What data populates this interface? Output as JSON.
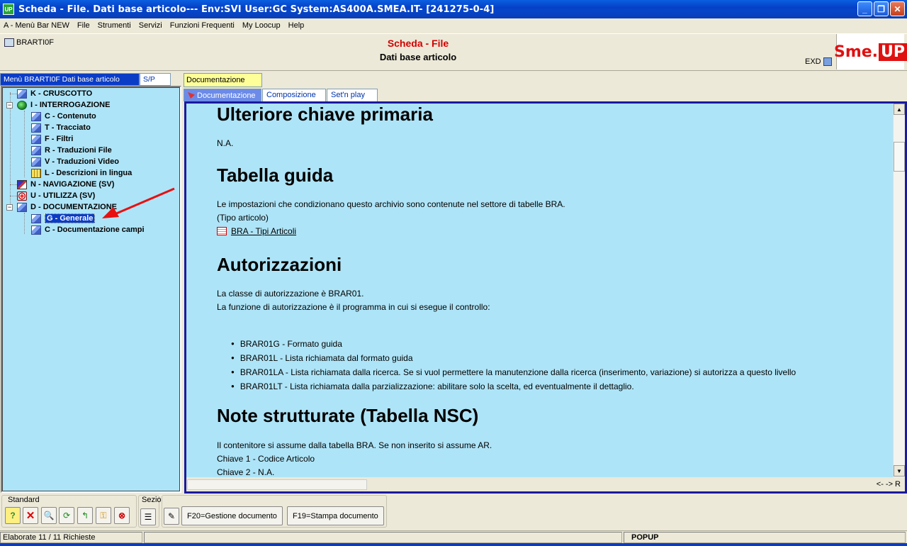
{
  "window": {
    "title": "Scheda - File. Dati base articolo--- Env:SVI User:GC System:AS400A.SMEA.IT- [241275-0-4]",
    "app_icon": "UP",
    "buttons": [
      "_",
      "❐",
      "✕"
    ]
  },
  "menu": [
    "A - Menù Bar NEW",
    "File",
    "Strumenti",
    "Servizi",
    "Funzioni Frequenti",
    "My Loocup",
    "Help"
  ],
  "header": {
    "object": "BRARTI0F",
    "title": "Scheda - File",
    "subtitle": "Dati base articolo",
    "exd": "EXD",
    "logo_left": "Sme.",
    "logo_right": "UP",
    "brand_color": "#e01010"
  },
  "left_panel": {
    "tab_active": "Menù BRARTI0F Dati base articolo",
    "tab_other": "S/P",
    "tree": [
      {
        "label": "K - CRUSCOTTO",
        "icon": "page-icon"
      },
      {
        "label": "I - INTERROGAZIONE",
        "icon": "globe-icon",
        "expander": "−"
      },
      {
        "label": "C - Contenuto",
        "icon": "page-icon"
      },
      {
        "label": "T - Tracciato",
        "icon": "page-icon"
      },
      {
        "label": "F - Filtri",
        "icon": "page-icon"
      },
      {
        "label": "R - Traduzioni File",
        "icon": "page-icon"
      },
      {
        "label": "V - Traduzioni Video",
        "icon": "page-icon"
      },
      {
        "label": "L - Descrizioni in lingua",
        "icon": "grid-icon"
      },
      {
        "label": "N - NAVIGAZIONE (SV)",
        "icon": "navigation-icon"
      },
      {
        "label": "U - UTILIZZA (SV)",
        "icon": "use-icon"
      },
      {
        "label": "D - DOCUMENTAZIONE",
        "icon": "page-icon",
        "expander": "−"
      },
      {
        "label": "G - Generale",
        "icon": "page-icon",
        "selected": true
      },
      {
        "label": "C - Documentazione campi",
        "icon": "page-icon"
      }
    ]
  },
  "right_panel": {
    "top_tab": "Documentazione",
    "tabs": [
      "Documentazione",
      "Composizione",
      "Set'n play"
    ],
    "nav": "<- -> R",
    "doc": {
      "h_ulteriore": "Ulteriore chiave primaria",
      "p_na": "N.A.",
      "h_tabella": "Tabella guida",
      "p_tab1": "Le impostazioni che condizionano questo archivio sono contenute nel settore di tabelle BRA.",
      "p_tab2": "(Tipo articolo)",
      "link_bra": "BRA - Tipi Articoli",
      "h_aut": "Autorizzazioni",
      "p_aut1": "La classe di autorizzazione è BRAR01.",
      "p_aut2": "La funzione di autorizzazione è il programma in cui si esegue il controllo:",
      "bullets": [
        "BRAR01G - Formato guida",
        "BRAR01L - Lista richiamata dal formato guida",
        "BRAR01LA - Lista richiamata dalla ricerca. Se si vuol permettere la manutenzione dalla ricerca (inserimento, variazione) si autorizza a questo livello",
        "BRAR01LT - Lista richiamata dalla parzializzazione: abilitare solo la scelta, ed eventualmente il dettaglio."
      ],
      "h_note": "Note strutturate (Tabella NSC)",
      "p_note1": "Il contenitore si assume dalla tabella BRA. Se non inserito si assume AR.",
      "p_note2": "Chiave 1 - Codice Articolo",
      "p_note3": "Chiave 2 - N.A."
    }
  },
  "toolbar": {
    "group_standard": "Standard",
    "group_sezio": "Sezio",
    "btn_f20": "F20=Gestione documento",
    "btn_f19": "F19=Stampa documento"
  },
  "status": {
    "left": "Elaborate 11 / 11 Richieste",
    "right": "POPUP"
  }
}
